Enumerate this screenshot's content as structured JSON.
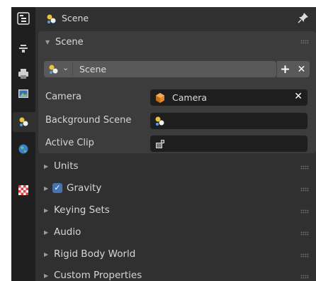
{
  "sidebar": {
    "tabs": [
      {
        "name": "tool",
        "icon": "tool-icon"
      },
      {
        "name": "scene-tab-render",
        "icon": "render-icon"
      },
      {
        "name": "output",
        "icon": "printer-icon"
      },
      {
        "name": "view-layer",
        "icon": "image-icon"
      },
      {
        "name": "scene",
        "icon": "scene-icon",
        "active": true
      },
      {
        "name": "world",
        "icon": "world-icon"
      },
      {
        "name": "texture",
        "icon": "checker-icon"
      }
    ]
  },
  "header": {
    "title": "Scene"
  },
  "scene_panel": {
    "title": "Scene",
    "selector_value": "Scene",
    "plus_label": "+",
    "close_label": "✕",
    "fields": [
      {
        "label": "Camera",
        "value": "Camera",
        "clear": "✕"
      },
      {
        "label": "Background Scene",
        "value": ""
      },
      {
        "label": "Active Clip",
        "value": ""
      }
    ]
  },
  "subpanels": [
    {
      "title": "Units"
    },
    {
      "title": "Gravity",
      "checked": true,
      "check_mark": "✓"
    },
    {
      "title": "Keying Sets"
    },
    {
      "title": "Audio"
    },
    {
      "title": "Rigid Body World"
    },
    {
      "title": "Custom Properties"
    }
  ],
  "colors": {
    "accent_check": "#4772b3",
    "camera_icon": "#e38b2c",
    "checker_icon": "#e04040"
  }
}
